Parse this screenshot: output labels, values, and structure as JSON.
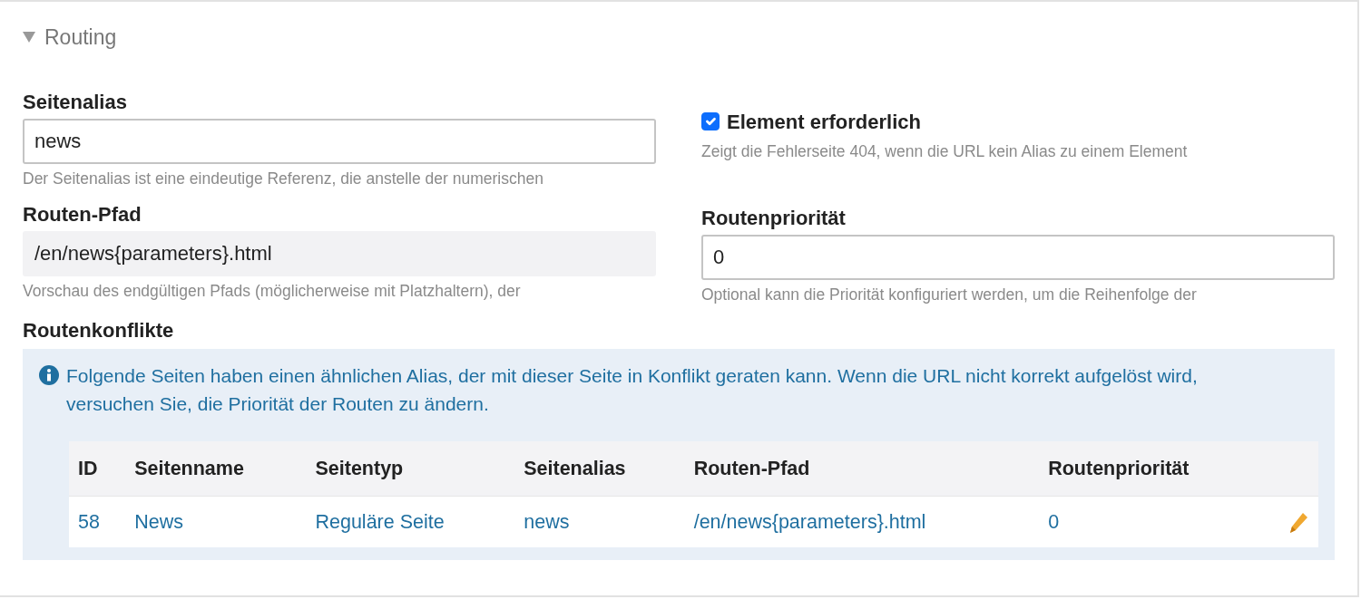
{
  "section": {
    "title": "Routing",
    "expanded": true
  },
  "left_fields": [
    {
      "kind": "text",
      "label": "Seitenalias",
      "value": "news",
      "readonly": false,
      "help": "Der Seitenalias ist eine eindeutige Referenz, die anstelle der numerischen"
    },
    {
      "kind": "text",
      "label": "Routen-Pfad",
      "value": "/en/news{parameters}.html",
      "readonly": true,
      "help": "Vorschau des endgültigen Pfads (möglicherweise mit Platzhaltern), der"
    }
  ],
  "right_fields": [
    {
      "kind": "checkbox",
      "label": "Element erforderlich",
      "checked": true,
      "help": "Zeigt die Fehlerseite 404, wenn die URL kein Alias zu einem Element"
    },
    {
      "kind": "text",
      "label": "Routenpriorität",
      "value": "0",
      "readonly": false,
      "help": "Optional kann die Priorität konfiguriert werden, um die Reihenfolge der"
    }
  ],
  "conflicts": {
    "label": "Routenkonflikte",
    "message": "Folgende Seiten haben einen ähnlichen Alias, der mit dieser Seite in Konflikt geraten kann. Wenn die URL nicht korrekt aufgelöst wird, versuchen Sie, die Priorität der Routen zu ändern.",
    "table": {
      "columns": [
        "ID",
        "Seitenname",
        "Seitentyp",
        "Seitenalias",
        "Routen-Pfad",
        "Routenpriorität"
      ],
      "rows": [
        {
          "cells": [
            "58",
            "News",
            "Reguläre Seite",
            "news",
            "/en/news{parameters}.html",
            "0"
          ],
          "editable": true
        }
      ]
    }
  }
}
